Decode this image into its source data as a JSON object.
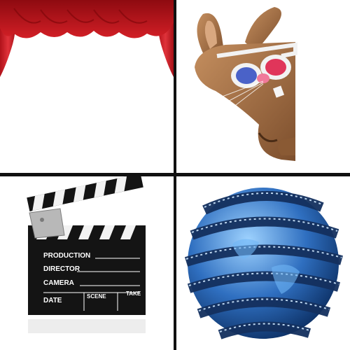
{
  "tiles": [
    {
      "subject": "theater-curtain"
    },
    {
      "subject": "rabbit-3d-glasses"
    },
    {
      "subject": "film-clapperboard"
    },
    {
      "subject": "film-strip-globe"
    }
  ],
  "clapperboard": {
    "production": "PRODUCTION",
    "director": "DIRECTOR",
    "camera": "CAMERA",
    "date": "DATE",
    "scene": "SCENE",
    "take": "TAKE"
  },
  "colors": {
    "curtain_red": "#c0141b",
    "rabbit_brown": "#a8734a",
    "glasses_blue": "#4a62c8",
    "glasses_red": "#e0355a",
    "clapper_black": "#141414",
    "globe_blue": "#2f6fc0"
  }
}
